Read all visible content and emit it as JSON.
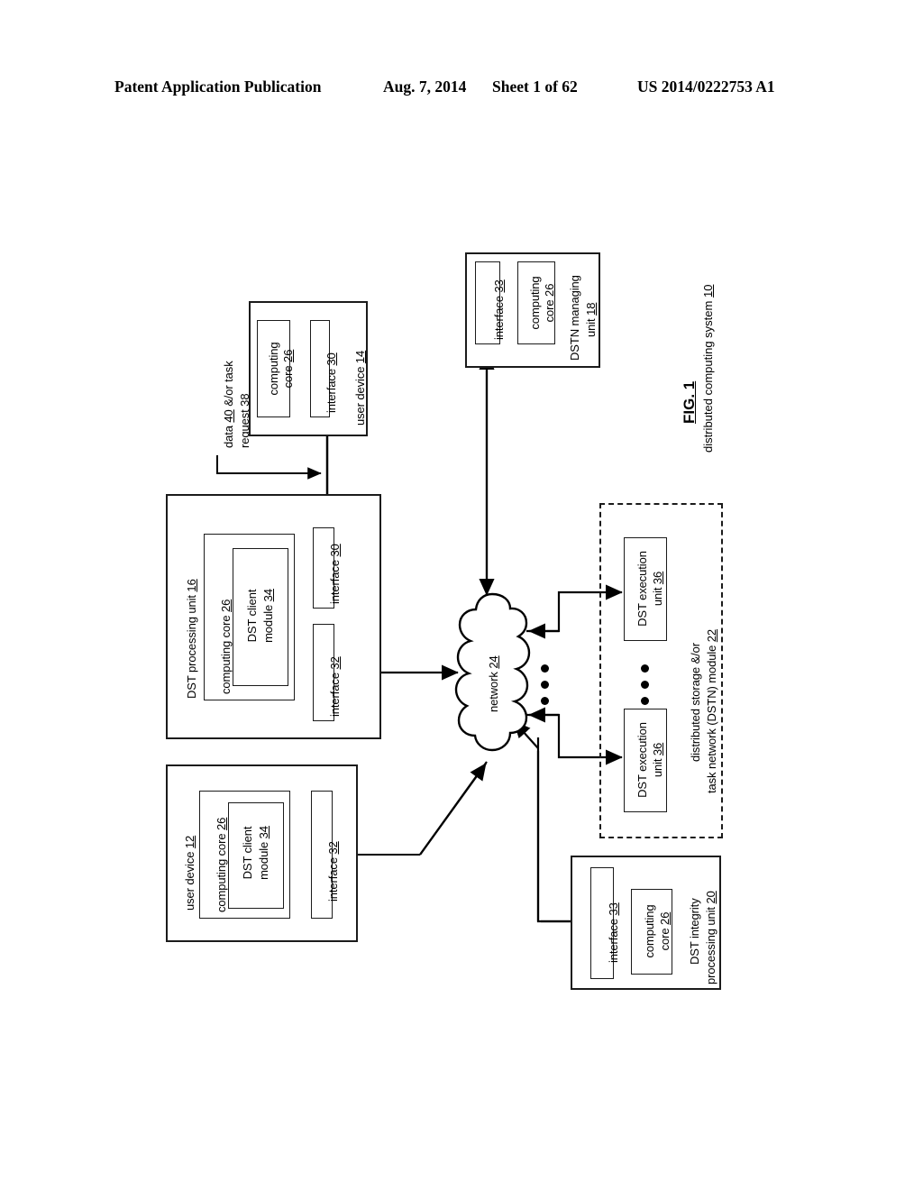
{
  "header": {
    "publication": "Patent Application Publication",
    "date": "Aug. 7, 2014",
    "sheet": "Sheet 1 of 62",
    "number": "US 2014/0222753 A1"
  },
  "figure": {
    "caption": "FIG. 1",
    "subcaption_text": "distributed computing system",
    "subcaption_ref": "10",
    "flow_label": {
      "line1_text": "data",
      "line1_ref": "40",
      "line1_tail": "&/or task",
      "line2_text": "request",
      "line2_ref": "38"
    },
    "network": {
      "label": "network",
      "ref": "24"
    },
    "user_device_14": {
      "title": "user device",
      "ref": "14",
      "computing_core": {
        "line1": "computing",
        "line2": "core",
        "ref": "26"
      },
      "interface": {
        "label": "interface",
        "ref": "30"
      }
    },
    "dst_processing_unit_16": {
      "title": "DST processing unit",
      "ref": "16",
      "computing_core": {
        "label": "computing core",
        "ref": "26"
      },
      "dst_client_module": {
        "line1": "DST client",
        "line2": "module",
        "ref": "34"
      },
      "interface_top": {
        "label": "interface",
        "ref": "30"
      },
      "interface_bottom": {
        "label": "interface",
        "ref": "32"
      }
    },
    "user_device_12": {
      "title": "user device",
      "ref": "12",
      "computing_core": {
        "label": "computing core",
        "ref": "26"
      },
      "dst_client_module": {
        "line1": "DST client",
        "line2": "module",
        "ref": "34"
      },
      "interface": {
        "label": "interface",
        "ref": "32"
      }
    },
    "dstn_managing_unit_18": {
      "title_line1": "DSTN managing",
      "title_line2": "unit",
      "ref": "18",
      "interface": {
        "label": "interface",
        "ref": "33"
      },
      "computing_core": {
        "line1": "computing",
        "line2": "core",
        "ref": "26"
      }
    },
    "dst_integrity_unit_20": {
      "title_line1": "DST integrity",
      "title_line2": "processing unit",
      "ref": "20",
      "interface": {
        "label": "interface",
        "ref": "33"
      },
      "computing_core": {
        "line1": "computing",
        "line2": "core",
        "ref": "26"
      }
    },
    "dstn_module_22": {
      "title_line1": "distributed storage &/or",
      "title_line2": "task network (DSTN) module",
      "ref": "22",
      "execution_units": [
        {
          "line1": "DST execution",
          "line2": "unit",
          "ref": "36"
        },
        {
          "line1": "DST execution",
          "line2": "unit",
          "ref": "36"
        }
      ],
      "ellipsis": "vertical-dots"
    }
  },
  "colors": {
    "ink": "#1b1b1b",
    "page": "#ffffff"
  }
}
